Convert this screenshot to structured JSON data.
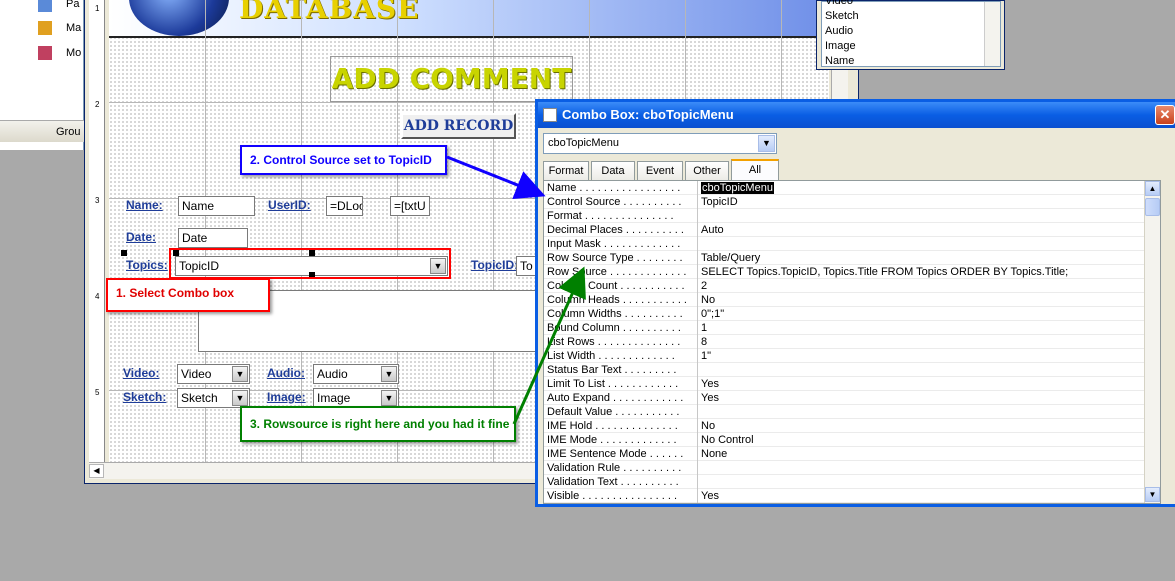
{
  "nav": {
    "items": [
      "Pa",
      "Ma",
      "Mo"
    ],
    "groups_label": "Grou"
  },
  "ruler": [
    "1",
    "2",
    "3",
    "4",
    "5"
  ],
  "form": {
    "header_title": "DATABASE",
    "add_comment": "ADD COMMENT",
    "add_record": "ADD RECORD",
    "labels": {
      "name": "Name:",
      "userid": "UserID:",
      "date": "Date:",
      "topics": "Topics:",
      "topicid": "TopicID:",
      "video": "Video:",
      "audio": "Audio:",
      "sketch": "Sketch:",
      "image": "Image:"
    },
    "fields": {
      "name": "Name",
      "userid": "=DLoo",
      "userid2": "=[txtU",
      "date": "Date",
      "topics": "TopicID",
      "topicid": "To",
      "video": "Video",
      "audio": "Audio",
      "sketch": "Sketch",
      "image": "Image"
    }
  },
  "list": {
    "items": [
      "Video",
      "Sketch",
      "Audio",
      "Image",
      "Name"
    ]
  },
  "props": {
    "title": "Combo Box: cboTopicMenu",
    "object": "cboTopicMenu",
    "tabs": [
      "Format",
      "Data",
      "Event",
      "Other",
      "All"
    ],
    "active_tab": "All",
    "rows": [
      {
        "name": "Name . . . . . . . . . . . . . . . . .",
        "value": "cboTopicMenu"
      },
      {
        "name": "Control Source . . . . . . . . . .",
        "value": "TopicID"
      },
      {
        "name": "Format . . . . . . . . . . . . . . .",
        "value": ""
      },
      {
        "name": "Decimal Places . . . . . . . . . .",
        "value": "Auto"
      },
      {
        "name": "Input Mask . . . . . . . . . . . . .",
        "value": ""
      },
      {
        "name": "Row Source Type . . . . . . . .",
        "value": "Table/Query"
      },
      {
        "name": "Row Source . . . . . . . . . . . . .",
        "value": "SELECT Topics.TopicID, Topics.Title FROM Topics ORDER BY Topics.Title;"
      },
      {
        "name": "Column Count . . . . . . . . . . .",
        "value": "2"
      },
      {
        "name": "Column Heads . . . . . . . . . . .",
        "value": "No"
      },
      {
        "name": "Column Widths . . . . . . . . . .",
        "value": "0\";1\""
      },
      {
        "name": "Bound Column . . . . . . . . . .",
        "value": "1"
      },
      {
        "name": "List Rows . . . . . . . . . . . . . .",
        "value": "8"
      },
      {
        "name": "List Width . . . . . . . . . . . . .",
        "value": "1\""
      },
      {
        "name": "Status Bar Text . . . . . . . . .",
        "value": ""
      },
      {
        "name": "Limit To List . . . . . . . . . . . .",
        "value": "Yes"
      },
      {
        "name": "Auto Expand . . . . . . . . . . . .",
        "value": "Yes"
      },
      {
        "name": "Default Value . . . . . . . . . . .",
        "value": ""
      },
      {
        "name": "IME Hold . . . . . . . . . . . . . .",
        "value": "No"
      },
      {
        "name": "IME Mode . . . . . . . . . . . . .",
        "value": "No Control"
      },
      {
        "name": "IME Sentence Mode . . . . . .",
        "value": "None"
      },
      {
        "name": "Validation Rule . . . . . . . . . .",
        "value": ""
      },
      {
        "name": "Validation Text . . . . . . . . . .",
        "value": ""
      },
      {
        "name": "Visible . . . . . . . . . . . . . . . .",
        "value": "Yes"
      }
    ]
  },
  "annotations": {
    "select_combo": "1. Select Combo box",
    "control_source": "2. Control Source set to TopicID",
    "rowsource": "3. Rowsource is right here and you had it fine"
  },
  "colors": {
    "annotation_red": "#ff0000",
    "annotation_blue": "#1000ff",
    "annotation_green": "#008000",
    "title_blue": "#0a5ee4"
  }
}
